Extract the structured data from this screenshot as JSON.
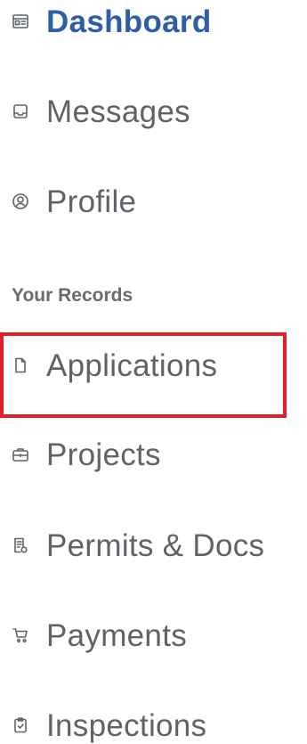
{
  "sidebar": {
    "items": [
      {
        "label": "Dashboard",
        "icon": "dashboard-icon",
        "active": true
      },
      {
        "label": "Messages",
        "icon": "inbox-icon",
        "active": false
      },
      {
        "label": "Profile",
        "icon": "user-circle-icon",
        "active": false
      }
    ],
    "section_heading": "Your Records",
    "records": [
      {
        "label": "Applications",
        "icon": "document-icon",
        "highlighted": true
      },
      {
        "label": "Projects",
        "icon": "briefcase-icon",
        "highlighted": false
      },
      {
        "label": "Permits & Docs",
        "icon": "permit-document-icon",
        "highlighted": false
      },
      {
        "label": "Payments",
        "icon": "cart-icon",
        "highlighted": false
      },
      {
        "label": "Inspections",
        "icon": "clipboard-icon",
        "highlighted": false
      }
    ]
  },
  "colors": {
    "active_text": "#2d5ea7",
    "text": "#5f6368",
    "highlight_border": "#e01f27"
  }
}
